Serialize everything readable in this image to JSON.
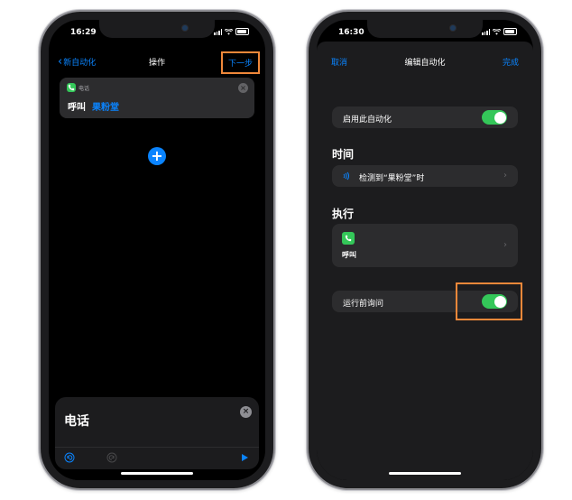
{
  "left_phone": {
    "status": {
      "time": "16:29"
    },
    "nav": {
      "back_label": "新自动化",
      "title": "操作",
      "next_label": "下一步"
    },
    "action": {
      "app_label": "电话",
      "verb": "呼叫",
      "contact": "果粉堂"
    },
    "add_symbol": "+",
    "bottom": {
      "search_text": "电话",
      "close_symbol": "×"
    }
  },
  "right_phone": {
    "status": {
      "time": "16:30"
    },
    "nav": {
      "cancel_label": "取消",
      "title": "编辑自动化",
      "done_label": "完成"
    },
    "enable_label": "启用此自动化",
    "when_header": "时间",
    "trigger_label": "检测到“果粉堂”时",
    "do_header": "执行",
    "action_label": "呼叫",
    "ask_label": "运行前询问",
    "chevron": "›"
  },
  "colors": {
    "accent": "#0a84ff",
    "toggle_on": "#34c759",
    "highlight": "#f0883a",
    "card": "#2c2c2e"
  }
}
